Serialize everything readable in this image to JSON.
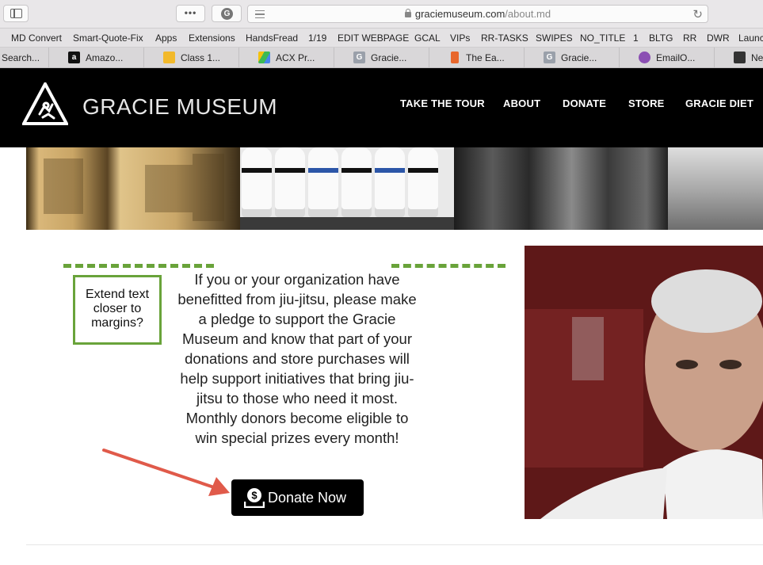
{
  "browser": {
    "url_host": "graciemuseum.com",
    "url_path": "/about.md",
    "more_label": "•••",
    "grammarly_letter": "G",
    "bookmarks": [
      "MD Convert",
      "Smart-Quote-Fix",
      "Apps",
      "Extensions",
      "HandsFread",
      "1/19",
      "EDIT WEBPAGE",
      "GCAL",
      "VIPs",
      "RR-TASKS",
      "SWIPES",
      "NO_TITLE",
      "1",
      "BLTG",
      "RR",
      "DWR",
      "Launc"
    ],
    "tabs": [
      {
        "label": "Search...",
        "favicon": ""
      },
      {
        "label": "Amazo...",
        "favicon": "a"
      },
      {
        "label": "Class 1...",
        "favicon": ""
      },
      {
        "label": "ACX Pr...",
        "favicon": ""
      },
      {
        "label": "Gracie...",
        "favicon": "G"
      },
      {
        "label": "The Ea...",
        "favicon": ""
      },
      {
        "label": "Gracie...",
        "favicon": "G"
      },
      {
        "label": "EmailO...",
        "favicon": ""
      },
      {
        "label": "New",
        "favicon": ""
      }
    ]
  },
  "site": {
    "brand": "GRACIE MUSEUM",
    "nav": [
      "TAKE THE TOUR",
      "ABOUT",
      "DONATE",
      "STORE",
      "GRACIE DIET"
    ],
    "pledge_text": "If you or your organization have benefitted from jiu-jitsu, please make a pledge to support the Gracie Museum and know that part of your donations and store purchases will help support initiatives that bring jiu-jitsu to those who need it most. Monthly donors become eligible to win special prizes every month!",
    "donate_label": "Donate Now"
  },
  "annotation": {
    "note": "Extend text closer to margins?"
  },
  "colors": {
    "accent_green": "#69a33a",
    "arrow_red": "#e05a4a",
    "header_bg": "#000000"
  }
}
